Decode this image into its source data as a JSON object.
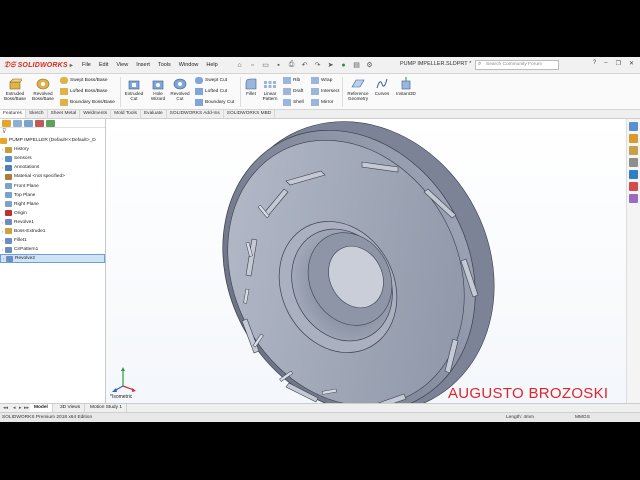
{
  "app": {
    "logo_text": "SOLIDWORKS",
    "document_title": "PUMP IMPELLER.SLDPRT *",
    "search_placeholder": "Search Community Forum"
  },
  "menu": [
    "File",
    "Edit",
    "View",
    "Insert",
    "Tools",
    "Window",
    "Help"
  ],
  "ribbon": {
    "extruded_boss": "Extruded Boss/Base",
    "revolved_boss": "Revolved Boss/Base",
    "swept_boss": "Swept Boss/Base",
    "lofted_boss": "Lofted Boss/Base",
    "boundary_boss": "Boundary Boss/Base",
    "extruded_cut": "Extruded Cut",
    "hole_wizard": "Hole Wizard",
    "revolved_cut": "Revolved Cut",
    "swept_cut": "Swept Cut",
    "lofted_cut": "Lofted Cut",
    "boundary_cut": "Boundary Cut",
    "fillet": "Fillet",
    "linear_pattern": "Linear Pattern",
    "rib": "Rib",
    "draft": "Draft",
    "shell": "Shell",
    "wrap": "Wrap",
    "intersect": "Intersect",
    "mirror": "Mirror",
    "reference_geometry": "Reference Geometry",
    "curves": "Curves",
    "instant3d": "Instant3D"
  },
  "command_tabs": [
    "Features",
    "Sketch",
    "Sheet Metal",
    "Weldments",
    "Mold Tools",
    "Evaluate",
    "SOLIDWORKS Add-Ins",
    "SOLIDWORKS MBD"
  ],
  "tree": {
    "root": "PUMP IMPELLER (Default<<Default>_D",
    "items": [
      {
        "label": "History",
        "icon": "history-icon",
        "color": "#c89a3a"
      },
      {
        "label": "Sensors",
        "icon": "sensor-icon",
        "color": "#5a8fc9"
      },
      {
        "label": "Annotations",
        "icon": "annotation-icon",
        "color": "#4a7fb8"
      },
      {
        "label": "Material <not specified>",
        "icon": "material-icon",
        "color": "#b07a3a"
      },
      {
        "label": "Front Plane",
        "icon": "plane-icon",
        "color": "#7aa3cc"
      },
      {
        "label": "Top Plane",
        "icon": "plane-icon",
        "color": "#7aa3cc"
      },
      {
        "label": "Right Plane",
        "icon": "plane-icon",
        "color": "#7aa3cc"
      },
      {
        "label": "Origin",
        "icon": "origin-icon",
        "color": "#c03030"
      },
      {
        "label": "Revolve1",
        "icon": "revolve-icon",
        "color": "#6a8ec4"
      },
      {
        "label": "Boss-Extrude1",
        "icon": "extrude-icon",
        "color": "#d0a040"
      },
      {
        "label": "Fillet1",
        "icon": "fillet-icon",
        "color": "#6a8ec4"
      },
      {
        "label": "CirPattern1",
        "icon": "pattern-icon",
        "color": "#6a8ec4"
      },
      {
        "label": "Revolve2",
        "icon": "revolve-icon",
        "color": "#6a8ec4"
      }
    ]
  },
  "viewport": {
    "view_name": "*Isometric",
    "watermark": "AUGUSTO BROZOSKI"
  },
  "bottom_tabs": [
    "Model",
    "3D Views",
    "Motion Study 1"
  ],
  "status": {
    "edition": "SOLIDWORKS Premium 2018 x64 Edition",
    "length": "Length: 4mm",
    "units": "MMGS"
  },
  "colors": {
    "accent": "#d52b1e",
    "part": "#9aa2b3",
    "part_dark": "#6c7385",
    "selection": "#cfe3f7"
  }
}
